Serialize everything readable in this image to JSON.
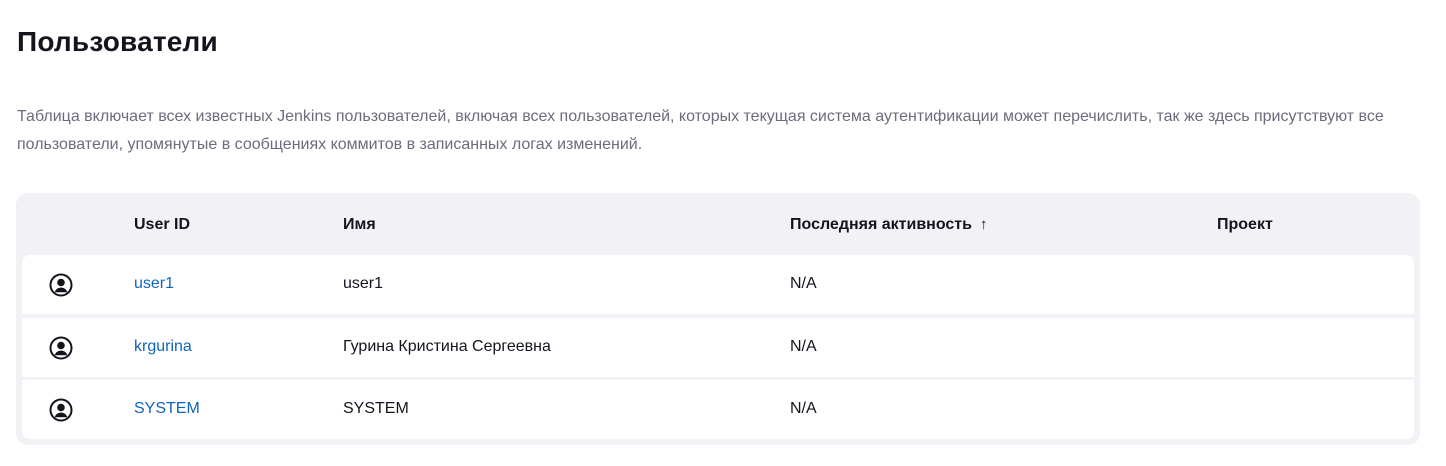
{
  "page": {
    "title": "Пользователи",
    "description": "Таблица включает всех известных Jenkins пользователей, включая всех пользователей, которых текущая система аутентификации может перечислить, так же здесь присутствуют все пользователи, упомянутые в сообщениях коммитов в записанных логах изменений."
  },
  "table": {
    "columns": {
      "user_id": "User ID",
      "name": "Имя",
      "last_activity": "Последняя активность",
      "last_activity_sort": "↑",
      "project": "Проект"
    },
    "rows": [
      {
        "avatar_icon": "user-circle-icon",
        "user_id": "user1",
        "name": "user1",
        "last_activity": "N/A",
        "project": ""
      },
      {
        "avatar_icon": "user-circle-icon",
        "user_id": "krgurina",
        "name": "Гурина Кристина Сергеевна",
        "last_activity": "N/A",
        "project": ""
      },
      {
        "avatar_icon": "user-circle-icon",
        "user_id": "SYSTEM",
        "name": "SYSTEM",
        "last_activity": "N/A",
        "project": ""
      }
    ]
  },
  "colors": {
    "link": "#1163c0",
    "muted_text": "#6d6b7d",
    "table_bg": "#f2f2f6"
  }
}
